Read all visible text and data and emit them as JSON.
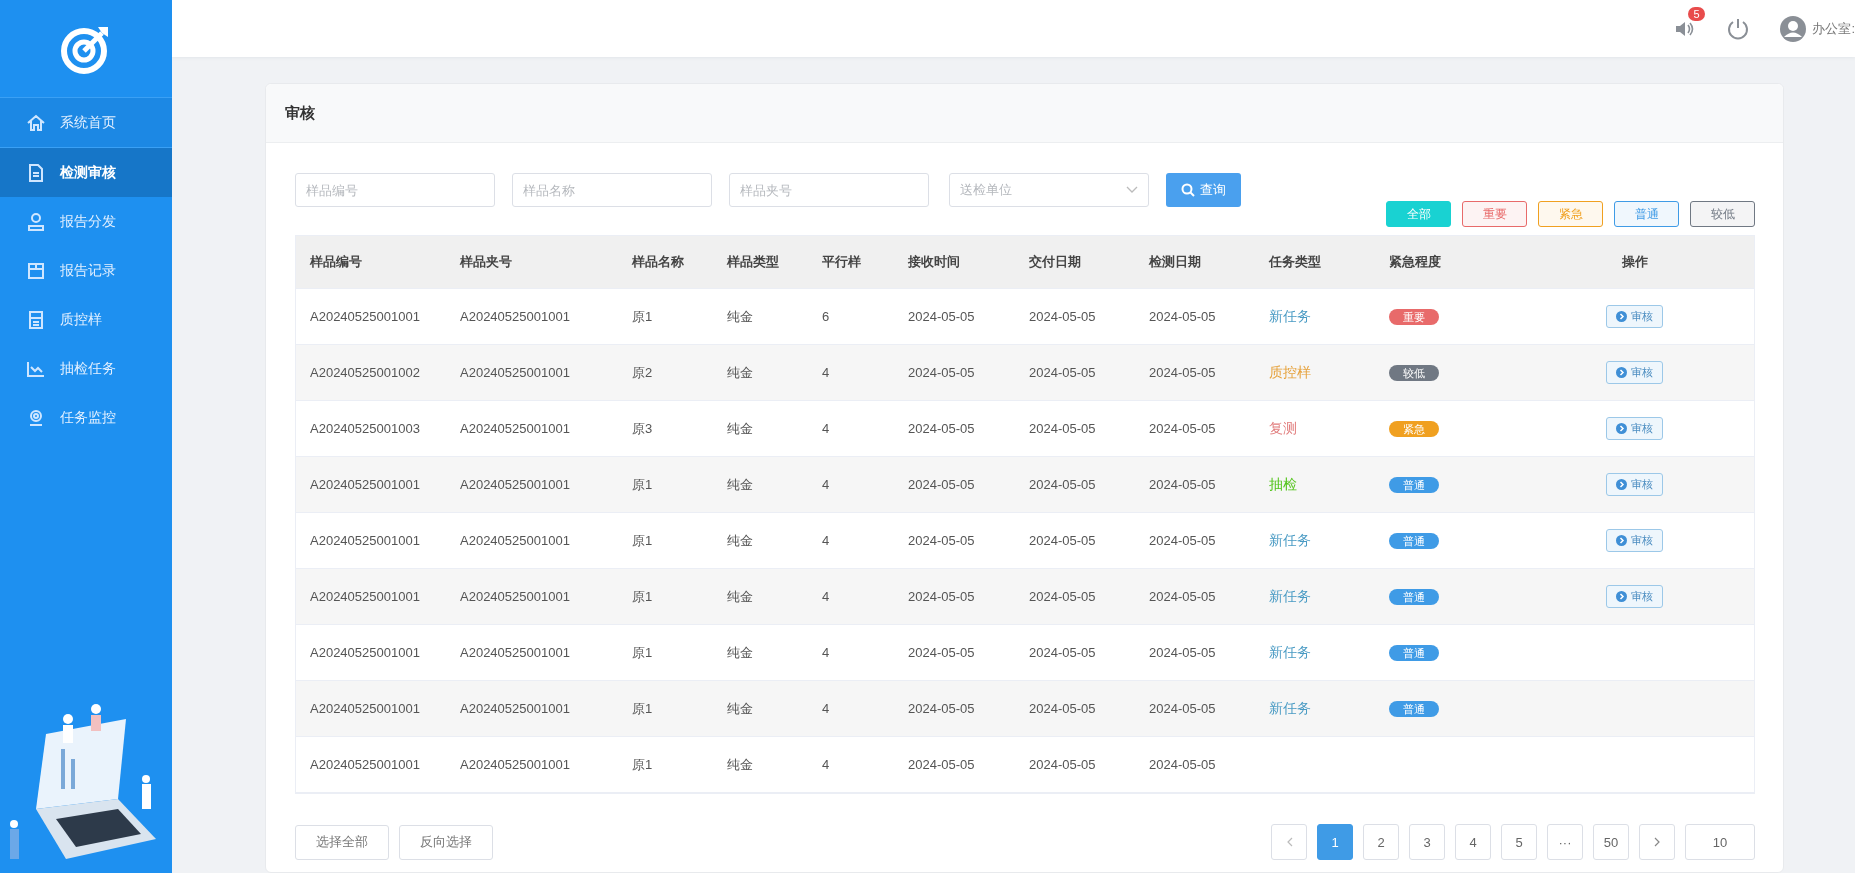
{
  "sidebar": {
    "items": [
      {
        "label": "系统首页",
        "selected": false
      },
      {
        "label": "检测审核",
        "selected": true
      },
      {
        "label": "报告分发",
        "selected": false
      },
      {
        "label": "报告记录",
        "selected": false
      },
      {
        "label": "质控样",
        "selected": false
      },
      {
        "label": "抽检任务",
        "selected": false
      },
      {
        "label": "任务监控",
        "selected": false
      }
    ]
  },
  "header": {
    "notification_count": "5",
    "user": "办公室:"
  },
  "panel": {
    "title": "审核"
  },
  "filters": {
    "fields": [
      {
        "kind": "input",
        "placeholder": "样品编号"
      },
      {
        "kind": "input",
        "placeholder": "样品名称"
      },
      {
        "kind": "input",
        "placeholder": "样品夹号"
      },
      {
        "kind": "select",
        "placeholder": "送检单位"
      }
    ],
    "search_button": "查询"
  },
  "urgency_tags": [
    {
      "label": "全部",
      "color": "#19d2d2",
      "selected": true
    },
    {
      "label": "重要",
      "color": "#e86a6a",
      "selected": false
    },
    {
      "label": "紧急",
      "color": "#f0a020",
      "selected": false
    },
    {
      "label": "普通",
      "color": "#3f9be6",
      "selected": false
    },
    {
      "label": "较低",
      "color": "#707883",
      "selected": false
    }
  ],
  "table": {
    "columns": [
      "样品编号",
      "样品夹号",
      "样品名称",
      "样品类型",
      "平行样",
      "接收时间",
      "交付日期",
      "检测日期",
      "任务类型",
      "紧急程度",
      "操作"
    ],
    "rows": [
      {
        "cells": [
          "A20240525001001",
          "A20240525001001",
          "原1",
          "纯金",
          "6",
          "2024-05-05",
          "2024-05-05",
          "2024-05-05"
        ],
        "task_type": {
          "text": "新任务",
          "color": "#4a9bc4"
        },
        "urgency": {
          "text": "重要",
          "color": "#e86a6a"
        },
        "action": "审核"
      },
      {
        "cells": [
          "A20240525001002",
          "A20240525001001",
          "原2",
          "纯金",
          "4",
          "2024-05-05",
          "2024-05-05",
          "2024-05-05"
        ],
        "task_type": {
          "text": "质控样",
          "color": "#e6a23c"
        },
        "urgency": {
          "text": "较低",
          "color": "#707883"
        },
        "action": "审核"
      },
      {
        "cells": [
          "A20240525001003",
          "A20240525001001",
          "原3",
          "纯金",
          "4",
          "2024-05-05",
          "2024-05-05",
          "2024-05-05"
        ],
        "task_type": {
          "text": "复测",
          "color": "#e07a7a"
        },
        "urgency": {
          "text": "紧急",
          "color": "#f0a020"
        },
        "action": "审核"
      },
      {
        "cells": [
          "A20240525001001",
          "A20240525001001",
          "原1",
          "纯金",
          "4",
          "2024-05-05",
          "2024-05-05",
          "2024-05-05"
        ],
        "task_type": {
          "text": "抽检",
          "color": "#52c41a"
        },
        "urgency": {
          "text": "普通",
          "color": "#3f9be6"
        },
        "action": "审核"
      },
      {
        "cells": [
          "A20240525001001",
          "A20240525001001",
          "原1",
          "纯金",
          "4",
          "2024-05-05",
          "2024-05-05",
          "2024-05-05"
        ],
        "task_type": {
          "text": "新任务",
          "color": "#4a9bc4"
        },
        "urgency": {
          "text": "普通",
          "color": "#3f9be6"
        },
        "action": "审核"
      },
      {
        "cells": [
          "A20240525001001",
          "A20240525001001",
          "原1",
          "纯金",
          "4",
          "2024-05-05",
          "2024-05-05",
          "2024-05-05"
        ],
        "task_type": {
          "text": "新任务",
          "color": "#4a9bc4"
        },
        "urgency": {
          "text": "普通",
          "color": "#3f9be6"
        },
        "action": "审核"
      },
      {
        "cells": [
          "A20240525001001",
          "A20240525001001",
          "原1",
          "纯金",
          "4",
          "2024-05-05",
          "2024-05-05",
          "2024-05-05"
        ],
        "task_type": {
          "text": "新任务",
          "color": "#4a9bc4"
        },
        "urgency": {
          "text": "普通",
          "color": "#3f9be6"
        }
      },
      {
        "cells": [
          "A20240525001001",
          "A20240525001001",
          "原1",
          "纯金",
          "4",
          "2024-05-05",
          "2024-05-05",
          "2024-05-05"
        ],
        "task_type": {
          "text": "新任务",
          "color": "#4a9bc4"
        },
        "urgency": {
          "text": "普通",
          "color": "#3f9be6"
        }
      },
      {
        "cells": [
          "A20240525001001",
          "A20240525001001",
          "原1",
          "纯金",
          "4",
          "2024-05-05",
          "2024-05-05",
          "2024-05-05"
        ]
      }
    ]
  },
  "footer_buttons": [
    "选择全部",
    "反向选择"
  ],
  "pagination": {
    "pages": [
      {
        "label": "1",
        "selected": true
      },
      {
        "label": "2",
        "selected": false
      },
      {
        "label": "3",
        "selected": false
      },
      {
        "label": "4",
        "selected": false
      },
      {
        "label": "5",
        "selected": false
      },
      {
        "label": "···",
        "selected": false
      },
      {
        "label": "50",
        "selected": false
      }
    ],
    "page_size": "10"
  }
}
